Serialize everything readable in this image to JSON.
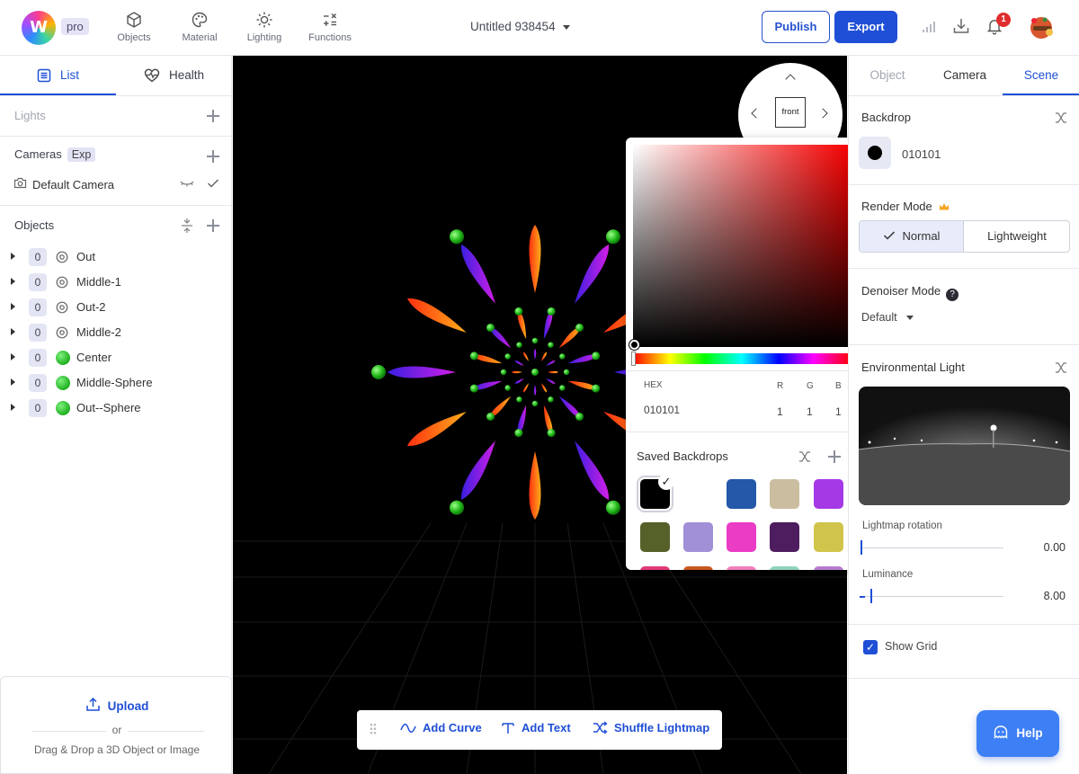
{
  "app": {
    "badge": "pro",
    "doc_title": "Untitled 938454",
    "nav": [
      "Objects",
      "Material",
      "Lighting",
      "Functions"
    ],
    "publish_label": "Publish",
    "export_label": "Export",
    "notification_count": "1"
  },
  "left": {
    "tabs": [
      "List",
      "Health"
    ],
    "lights_label": "Lights",
    "cameras_label": "Cameras",
    "cameras_tag": "Exp",
    "camera_item": "Default Camera",
    "objects_label": "Objects",
    "objects": [
      {
        "count": "0",
        "name": "Out",
        "icon": "camera-group-icon"
      },
      {
        "count": "0",
        "name": "Middle-1",
        "icon": "camera-group-icon"
      },
      {
        "count": "0",
        "name": "Out-2",
        "icon": "camera-group-icon"
      },
      {
        "count": "0",
        "name": "Middle-2",
        "icon": "camera-group-icon"
      },
      {
        "count": "0",
        "name": "Center",
        "icon": "sphere-icon"
      },
      {
        "count": "0",
        "name": "Middle-Sphere",
        "icon": "sphere-icon"
      },
      {
        "count": "0",
        "name": "Out--Sphere",
        "icon": "sphere-icon"
      }
    ],
    "upload_label": "Upload",
    "or_label": "or",
    "drag_label": "Drag & Drop a 3D Object or Image"
  },
  "viewport": {
    "view_label": "front",
    "toolbar": [
      "Add Curve",
      "Add Text",
      "Shuffle Lightmap"
    ]
  },
  "picker": {
    "hex_label": "HEX",
    "hex_value": "010101",
    "r_label": "R",
    "g_label": "G",
    "b_label": "B",
    "r": "1",
    "g": "1",
    "b": "1",
    "saved_title": "Saved Backdrops",
    "swatches": [
      "#000000",
      "#ffffff",
      "#2458a8",
      "#cbbd9f",
      "#a639e6",
      "#566029",
      "#a18fd7",
      "#ea3cc5",
      "#4e1d5f",
      "#d0c54a"
    ]
  },
  "right": {
    "tabs": [
      "Object",
      "Camera",
      "Scene"
    ],
    "backdrop_label": "Backdrop",
    "backdrop_value": "010101",
    "render_mode_label": "Render Mode",
    "render_normal": "Normal",
    "render_lightweight": "Lightweight",
    "denoiser_label": "Denoiser Mode",
    "denoiser_value": "Default",
    "env_light_label": "Environmental Light",
    "lightmap_rotation_label": "Lightmap rotation",
    "lightmap_rotation_value": "0.00",
    "luminance_label": "Luminance",
    "luminance_value": "8.00",
    "show_grid_label": "Show Grid",
    "help_label": "Help"
  }
}
